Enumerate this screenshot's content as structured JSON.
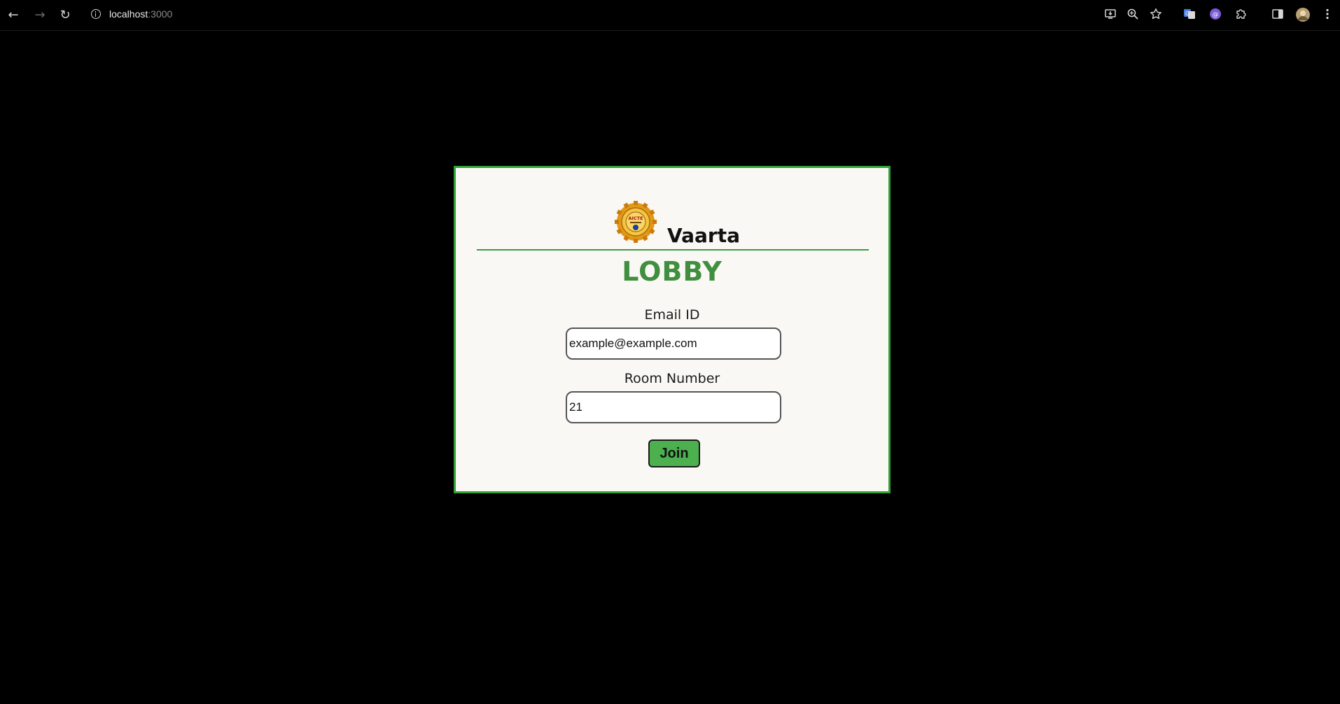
{
  "browser": {
    "url_host": "localhost",
    "url_port": ":3000",
    "icons": {
      "back": "back-arrow-icon",
      "forward": "forward-arrow-icon",
      "reload": "reload-icon",
      "site_info": "info-icon",
      "install": "install-app-icon",
      "zoom": "zoom-icon",
      "bookmark": "star-icon",
      "translate": "translate-icon",
      "extension": "extension-icon",
      "extensions_menu": "puzzle-icon",
      "side_panel": "side-panel-icon",
      "profile": "avatar",
      "menu": "kebab-menu-icon"
    }
  },
  "lobby": {
    "app_name": "Vaarta",
    "logo_text": "AICTE",
    "title": "LOBBY",
    "email_label": "Email ID",
    "email_value": "example@example.com",
    "room_label": "Room Number",
    "room_value": "21",
    "join_label": "Join"
  },
  "colors": {
    "page_background": "#000000",
    "card_background": "#f9f8f4",
    "card_border": "#33a037",
    "title_green": "#3f8f3f",
    "button_green": "#4cb04f"
  }
}
